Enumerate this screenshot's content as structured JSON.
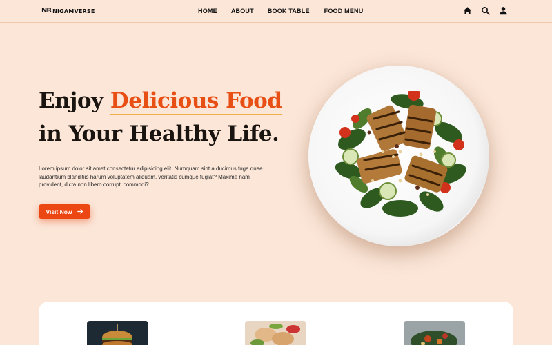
{
  "brand": {
    "logo_mark": "NR",
    "name": "NIGAMVERSE"
  },
  "nav": {
    "items": [
      {
        "label": "HOME"
      },
      {
        "label": "ABOUT"
      },
      {
        "label": "BOOK TABLE"
      },
      {
        "label": "FOOD MENU"
      }
    ],
    "icons": [
      "home-icon",
      "search-icon",
      "user-icon"
    ]
  },
  "hero": {
    "title_prefix": "Enjoy ",
    "title_highlight": "Delicious Food",
    "title_line2": "in Your Healthy Life.",
    "description": "Lorem ipsum dolor sit amet consectetur adipisicing elit. Numquam sint a ducimus fuga quae laudantium blanditiis harum voluptatem aliquam, veritatis cumque fugiat? Maxime nam provident, dicta non libero corrupti commodi?",
    "button_label": "Visit Now"
  },
  "colors": {
    "background": "#fbe6d8",
    "accent": "#ec4712",
    "highlight_underline": "#f0b144",
    "card_background": "#ffffff"
  },
  "cards": {
    "images": [
      "burger",
      "dumplings",
      "salad-bowl"
    ]
  }
}
